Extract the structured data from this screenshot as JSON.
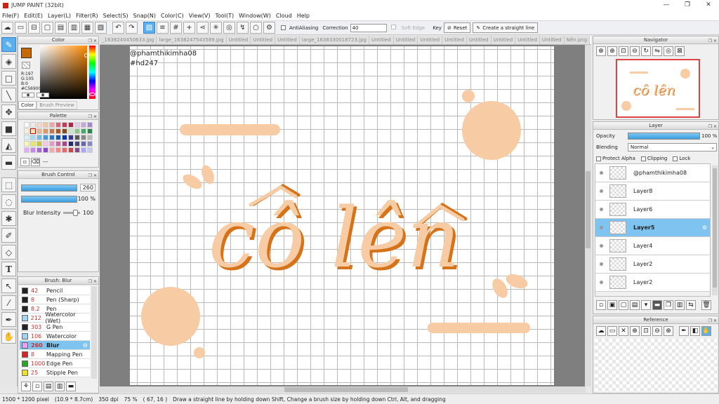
{
  "window": {
    "title": "JUMP PAINT (32bit)",
    "min": "—",
    "restore": "❐",
    "close": "✕"
  },
  "menu": [
    "File(F)",
    "Edit(E)",
    "Layer(L)",
    "Filter(R)",
    "Select(S)",
    "Snap(N)",
    "Color(C)",
    "View(V)",
    "Tool(T)",
    "Window(W)",
    "Cloud",
    "Help"
  ],
  "toolbar": {
    "antialias": "AntiAliasing",
    "correction_label": "Correction",
    "correction_value": "40",
    "soft_edge": "Soft Edge",
    "key": "Key",
    "reset": "Reset",
    "straight_line": "Create a straight line"
  },
  "tabs": [
    "_1638240450633.jpg",
    "large_1638247543589.jpg",
    "Untitled",
    "Untitled",
    "Untitled",
    "large_1638330018723.jpg",
    "Untitled",
    "Untitled",
    "Untitled",
    "Untitled",
    "Untitled",
    "Untitled",
    "Untitled",
    "Untitled",
    "Nền.png",
    "Nền.png"
  ],
  "color_panel": {
    "title": "Color",
    "r": "R:197",
    "g": "G:105",
    "b": "B:0",
    "hex": "#C56900",
    "tab1": "Color",
    "tab2": "Brush Preview",
    "main_color": "#c56900"
  },
  "palette_panel": {
    "title": "Palette",
    "more": "---"
  },
  "brush_control": {
    "title": "Brush Control",
    "size": "260",
    "opacity": "100 %",
    "blur_label": "Blur Intensity",
    "blur_value": "100"
  },
  "brush_list": {
    "title": "Brush: Blur",
    "items": [
      {
        "size": "42",
        "name": "Pencil",
        "color": "#222222"
      },
      {
        "size": "8",
        "name": "Pen (Sharp)",
        "color": "#222222"
      },
      {
        "size": "8.2",
        "name": "Pen",
        "color": "#222222"
      },
      {
        "size": "212",
        "name": "Watercolor (Wet)",
        "color": "#9fd4f5"
      },
      {
        "size": "303",
        "name": "G Pen",
        "color": "#222222"
      },
      {
        "size": "106",
        "name": "Watercolor",
        "color": "#9fd4f5"
      },
      {
        "size": "260",
        "name": "Blur",
        "color": "#f0a0f0"
      },
      {
        "size": "8",
        "name": "Mapping Pen",
        "color": "#dd2222"
      },
      {
        "size": "1000",
        "name": "Edge Pen",
        "color": "#22aa22"
      },
      {
        "size": "25",
        "name": "Stipple Pen",
        "color": "#f0e020"
      }
    ]
  },
  "canvas": {
    "watermark_line1": "@phamthikimha08",
    "watermark_line2": "#hd247",
    "artwork_text": "cô lên",
    "art_color": "#f7cba4",
    "art_shadow": "#d4731a"
  },
  "navigator": {
    "title": "Navigator"
  },
  "layer_panel": {
    "title": "Layer",
    "opacity_label": "Opacity",
    "opacity_value": "100 %",
    "blending_label": "Blending",
    "blending_value": "Normal",
    "protect_alpha": "Protect Alpha",
    "clipping": "Clipping",
    "lock": "Lock",
    "layers": [
      "@phamthikimha08",
      "Layer8",
      "Layer6",
      "Layer5",
      "Layer4",
      "Layer2",
      "Layer2"
    ]
  },
  "reference_panel": {
    "title": "Reference"
  },
  "status": {
    "size": "1500 * 1200 pixel",
    "cm": "(10.9 * 8.7cm)",
    "dpi": "350 dpi",
    "zoom": "75 %",
    "coords": "( 67, 16 )",
    "hint": "Draw a straight line by holding down Shift, Change a brush size by holding down Ctrl, Alt, and dragging"
  }
}
